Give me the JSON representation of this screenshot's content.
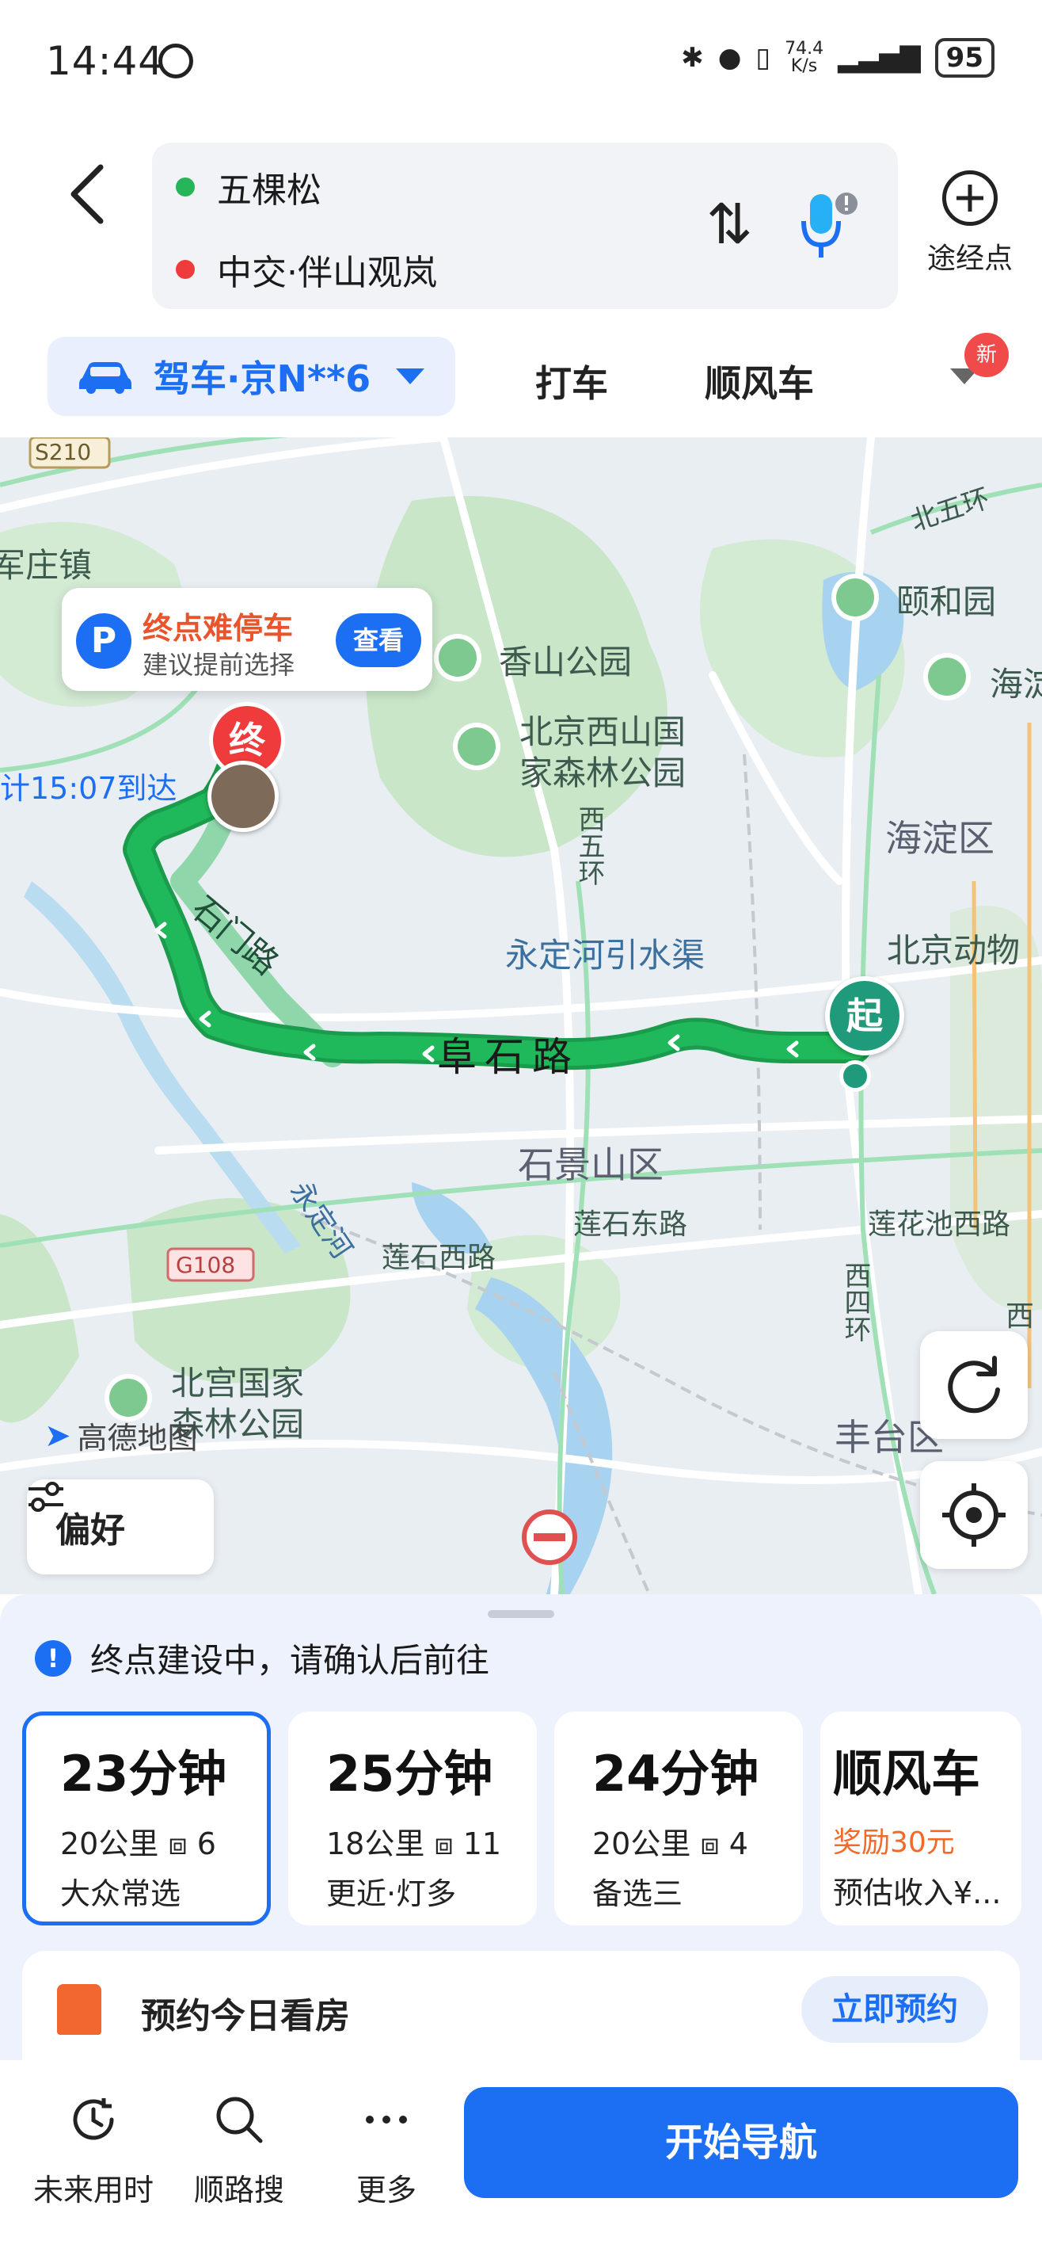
{
  "status_bar": {
    "time": "14:44",
    "net_speed_value": "74.4",
    "net_speed_unit": "K/s",
    "battery": "95"
  },
  "route": {
    "origin": "五棵松",
    "destination": "中交·伴山观岚",
    "waypoint_label": "途经点",
    "origin_color": "#27b55a",
    "destination_color": "#ef3b3b"
  },
  "modes": {
    "drive": "驾车·京N**6",
    "taxi": "打车",
    "carpool": "顺风车",
    "new_badge": "新"
  },
  "map": {
    "parking_card": {
      "icon": "P",
      "title": "终点难停车",
      "subtitle": "建议提前选择",
      "button": "查看"
    },
    "eta_label": "计15:07到达",
    "end_marker": "终",
    "start_marker": "起",
    "labels": {
      "s210": "S210",
      "g108": "G108",
      "junzhuang": "军庄镇",
      "xiangshan": "香山公园",
      "xishan_1": "北京西山国",
      "xishan_2": "家森林公园",
      "yiheyuan": "颐和园",
      "haidian_edge": "海淀",
      "beiwuhuan": "北五环",
      "haidianqu": "海淀区",
      "zoo": "北京动物",
      "xiwuhuan": "西五环",
      "yongding_canal": "永定河引水渠",
      "shimen": "石门路",
      "fushi": "阜石路",
      "shijingshan": "石景山区",
      "lianshidong": "莲石东路",
      "lianhuachi": "莲花池西路",
      "yongdinghe": "永定河",
      "lianshixi": "莲石西路",
      "xisihuan": "西四环",
      "beigong_1": "北宫国家",
      "beigong_2": "森林公园",
      "fengtai": "丰台区",
      "xi_edge": "西"
    },
    "brand": "高德地图",
    "preference": "偏好",
    "route_color": "#1fb85a"
  },
  "sheet": {
    "notice": "终点建设中，请确认后前往",
    "options": [
      {
        "time": "23分钟",
        "dist": "20公里",
        "lights": "6",
        "tag": "大众常选"
      },
      {
        "time": "25分钟",
        "dist": "18公里",
        "lights": "11",
        "tag": "更近·灯多"
      },
      {
        "time": "24分钟",
        "dist": "20公里",
        "lights": "4",
        "tag": "备选三"
      }
    ],
    "carpool": {
      "title": "顺风车",
      "reward": "奖励30元",
      "income": "预估收入¥..."
    },
    "house": {
      "title": "预约今日看房",
      "button": "立即预约"
    }
  },
  "bottom_bar": {
    "future": "未来用时",
    "search": "顺路搜",
    "more": "更多",
    "start_nav": "开始导航"
  },
  "colors": {
    "accent": "#1c6ef3",
    "route_green": "#1fb85a",
    "warn_orange": "#e8542b"
  }
}
